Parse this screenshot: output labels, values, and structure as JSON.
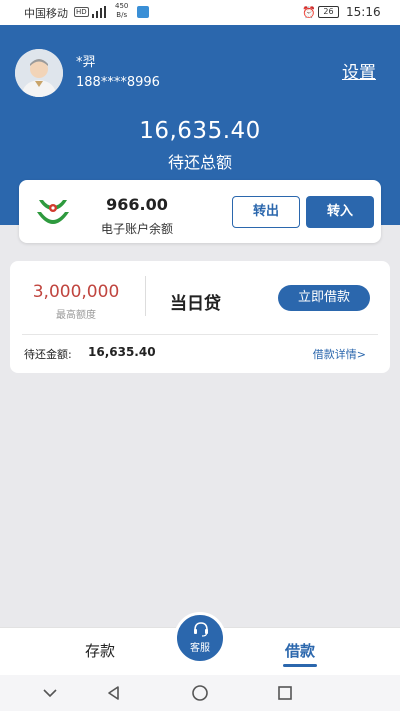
{
  "status_bar": {
    "carrier": "中国移动",
    "hd": "HD",
    "speed_value": "450",
    "speed_unit": "B/s",
    "battery": "26",
    "time": "15:16"
  },
  "header": {
    "user_name": "*羿",
    "user_phone": "188****8996",
    "settings_label": "设置",
    "total_amount": "16,635.40",
    "total_label": "待还总额"
  },
  "account": {
    "balance": "966.00",
    "balance_label": "电子账户余额",
    "transfer_out_label": "转出",
    "transfer_in_label": "转入"
  },
  "loan": {
    "limit": "3,000,000",
    "limit_label": "最高额度",
    "product_name": "当日贷",
    "borrow_label": "立即借款",
    "repay_label": "待还金额:",
    "repay_amount": "16,635.40",
    "detail_label": "借款详情>"
  },
  "tabbar": {
    "deposit_label": "存款",
    "customer_service_label": "客服",
    "loan_label": "借款",
    "active_tab": "借款"
  },
  "colors": {
    "primary": "#2b67ad",
    "limit_red": "#c0453f",
    "background": "#e9e9ec"
  },
  "icons": [
    "signal-icon",
    "message-icon",
    "alarm-icon",
    "bank-logo",
    "headset-icon",
    "back-icon",
    "home-icon",
    "recents-icon",
    "chevron-down-icon"
  ]
}
